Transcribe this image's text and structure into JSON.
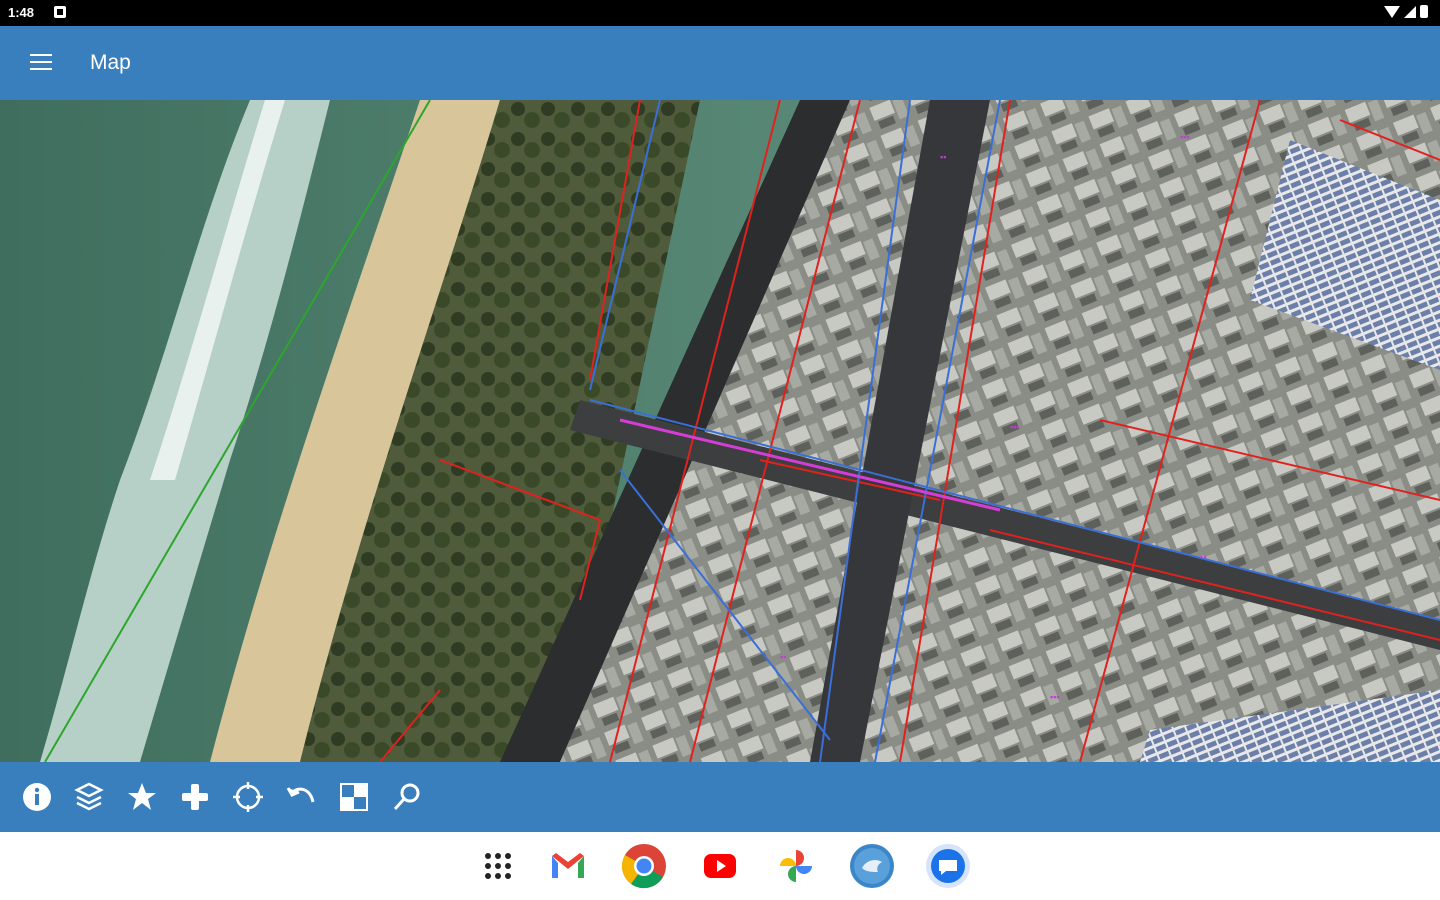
{
  "status": {
    "time": "1:48"
  },
  "appbar": {
    "title": "Map"
  },
  "toolbar": {
    "tools": [
      {
        "icon": "info-icon"
      },
      {
        "icon": "layers-icon"
      },
      {
        "icon": "star-icon"
      },
      {
        "icon": "plus-icon"
      },
      {
        "icon": "locate-icon"
      },
      {
        "icon": "undo-icon"
      },
      {
        "icon": "basemap-icon"
      },
      {
        "icon": "search-icon"
      }
    ]
  },
  "dock": {
    "apps": [
      "app-drawer-icon",
      "gmail-icon",
      "chrome-icon",
      "youtube-icon",
      "photos-icon",
      "app-icon",
      "messages-icon"
    ]
  },
  "colors": {
    "appbar": "#3a7fbd",
    "parcel": "#e0221e",
    "road": "#3a6fd8",
    "easement": "#22aa22",
    "label": "#c23cd6"
  }
}
